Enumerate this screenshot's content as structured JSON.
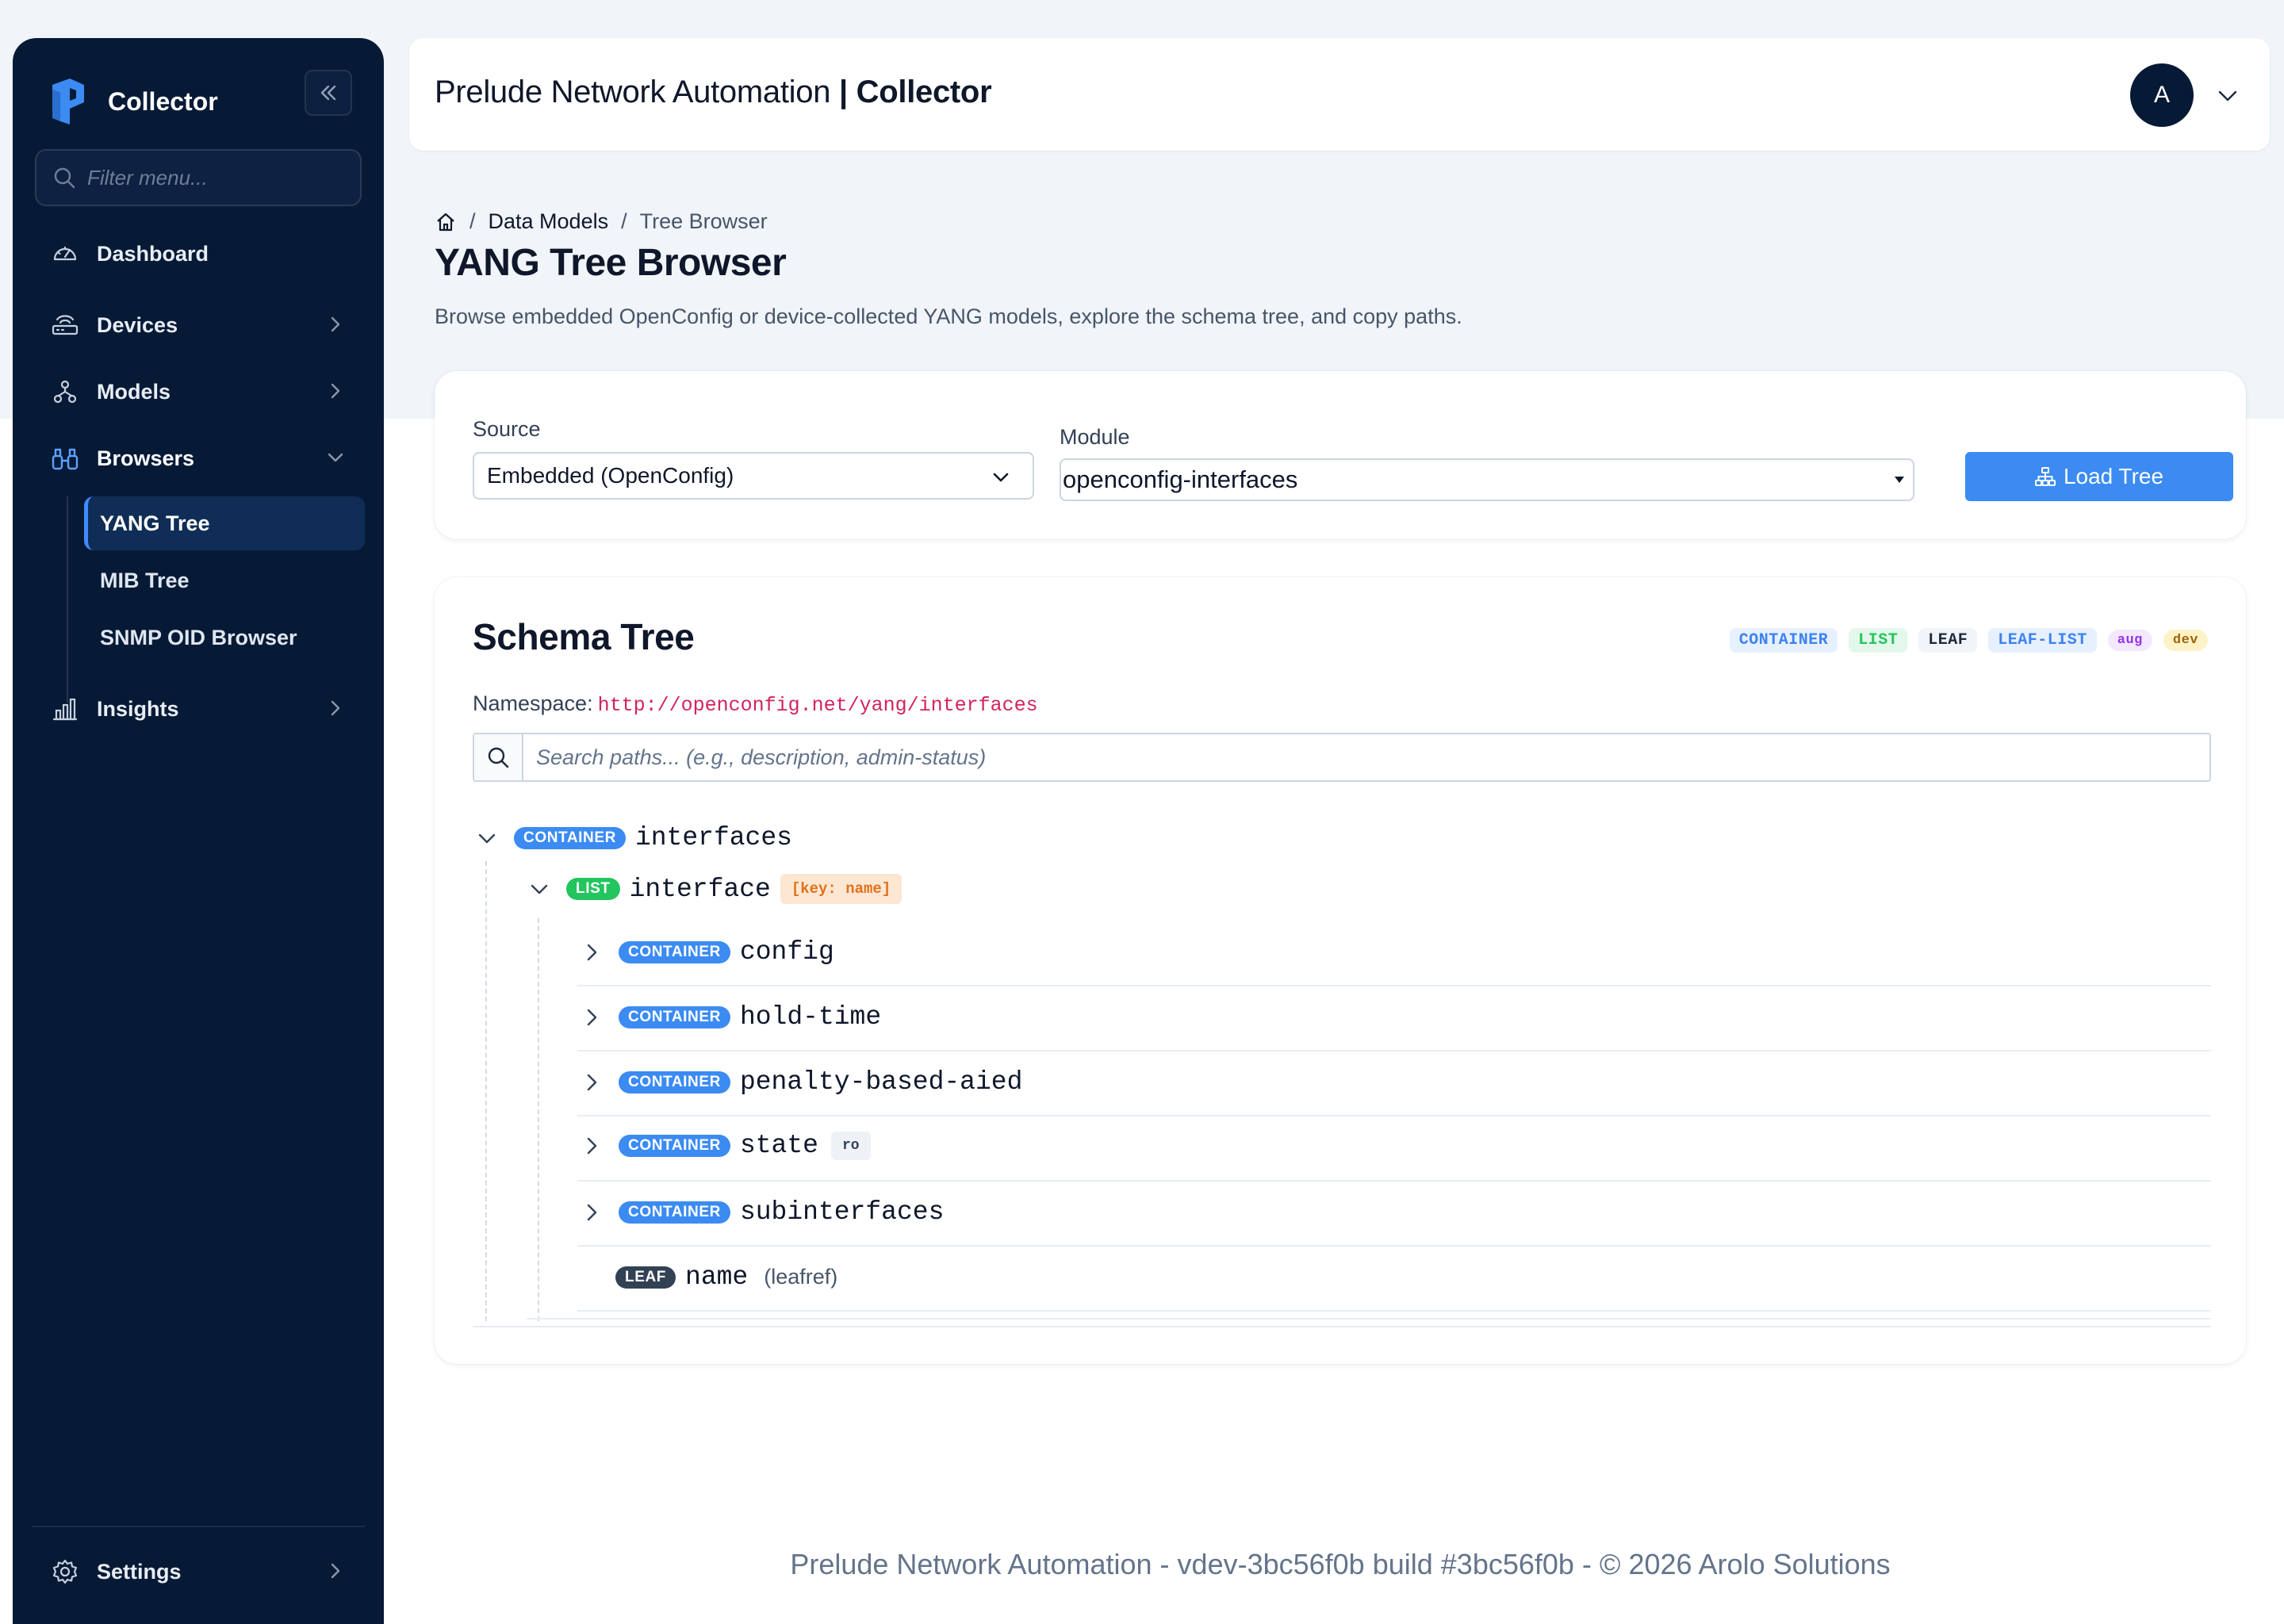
{
  "sidebar": {
    "brand": "Collector",
    "filter_placeholder": "Filter menu...",
    "items": [
      {
        "label": "Dashboard",
        "icon": "gauge-icon"
      },
      {
        "label": "Devices",
        "icon": "router-icon"
      },
      {
        "label": "Models",
        "icon": "hierarchy-icon"
      },
      {
        "label": "Browsers",
        "icon": "binoculars-icon"
      },
      {
        "label": "Insights",
        "icon": "bar-chart-icon"
      }
    ],
    "browsers_sub": [
      "YANG Tree",
      "MIB Tree",
      "SNMP OID Browser"
    ],
    "active_sub": "YANG Tree",
    "settings": "Settings"
  },
  "header": {
    "title_main": "Prelude Network Automation",
    "title_sep": " | ",
    "title_bold": "Collector",
    "avatar_initial": "A"
  },
  "page": {
    "breadcrumb": [
      "Data Models",
      "Tree Browser"
    ],
    "title": "YANG Tree Browser",
    "subtitle": "Browse embedded OpenConfig or device-collected YANG models, explore the schema tree, and copy paths."
  },
  "controls": {
    "source_label": "Source",
    "source_value": "Embedded (OpenConfig)",
    "module_label": "Module",
    "module_value": "openconfig-interfaces",
    "load_button": "Load Tree"
  },
  "schema": {
    "title": "Schema Tree",
    "legend": [
      {
        "label": "CONTAINER",
        "fg": "#3b82f6",
        "bg": "#e7f0fe"
      },
      {
        "label": "LIST",
        "fg": "#22c55e",
        "bg": "#e3f8ea"
      },
      {
        "label": "LEAF",
        "fg": "#1e293b",
        "bg": "#f1f5f9"
      },
      {
        "label": "LEAF-LIST",
        "fg": "#3b82f6",
        "bg": "#e7f0fe"
      },
      {
        "label": "aug",
        "fg": "#9333ea",
        "bg": "#f3e8ff"
      },
      {
        "label": "dev",
        "fg": "#a16207",
        "bg": "#fef3c7"
      }
    ],
    "namespace_label": "Namespace:",
    "namespace": "http://openconfig.net/yang/interfaces",
    "search_placeholder": "Search paths... (e.g., description, admin-status)",
    "nodes": [
      {
        "kind": "CONTAINER",
        "name": "interfaces",
        "expanded": true
      },
      {
        "kind": "LIST",
        "name": "interface",
        "expanded": true,
        "tag": "[key: name]"
      },
      {
        "kind": "CONTAINER",
        "name": "config"
      },
      {
        "kind": "CONTAINER",
        "name": "hold-time"
      },
      {
        "kind": "CONTAINER",
        "name": "penalty-based-aied"
      },
      {
        "kind": "CONTAINER",
        "name": "state",
        "tag": "ro"
      },
      {
        "kind": "CONTAINER",
        "name": "subinterfaces"
      },
      {
        "kind": "LEAF",
        "name": "name",
        "type": "(leafref)"
      }
    ]
  },
  "footer": "Prelude Network Automation - vdev-3bc56f0b build #3bc56f0b - © 2026 Arolo Solutions"
}
